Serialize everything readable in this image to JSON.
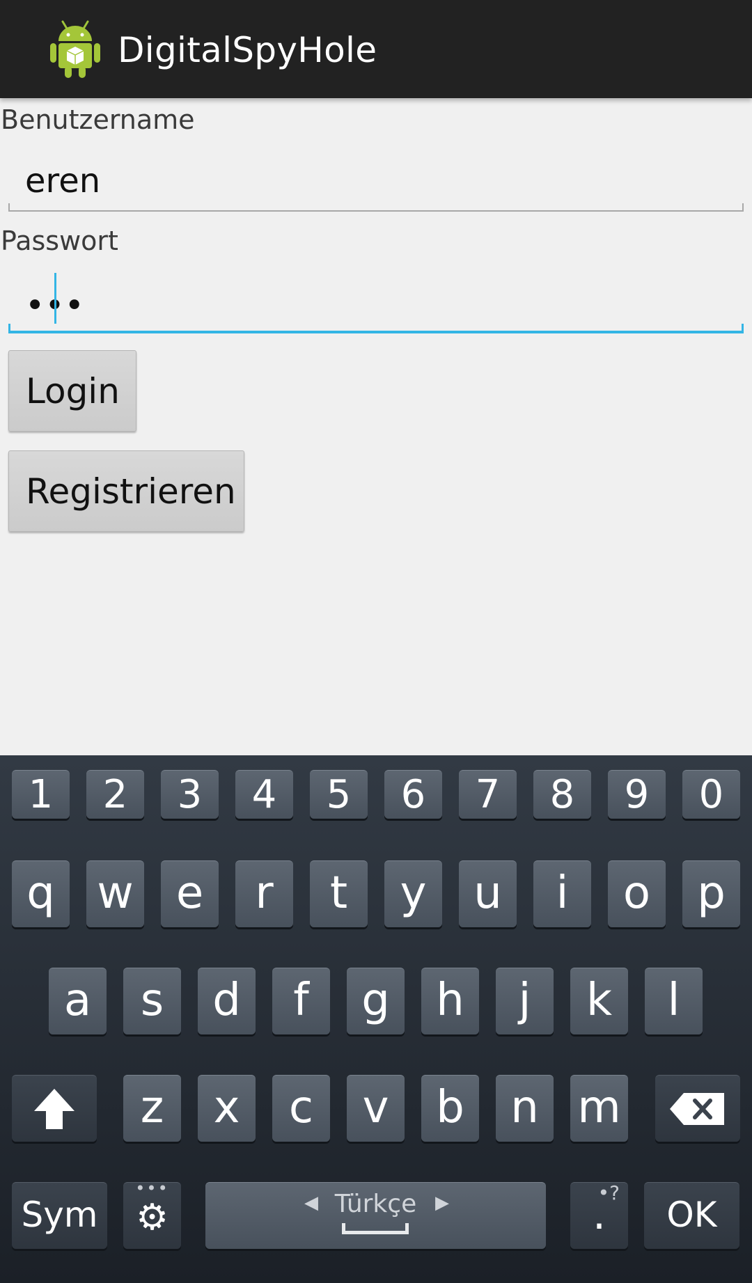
{
  "action_bar": {
    "title": "DigitalSpyHole",
    "icon": "android-robot-icon"
  },
  "form": {
    "username_label": "Benutzername",
    "username_value": "eren",
    "password_label": "Passwort",
    "password_value": "•••",
    "login_button": "Login",
    "register_button": "Registrieren"
  },
  "keyboard": {
    "number_row": [
      "1",
      "2",
      "3",
      "4",
      "5",
      "6",
      "7",
      "8",
      "9",
      "0"
    ],
    "row1": [
      "q",
      "w",
      "e",
      "r",
      "t",
      "y",
      "u",
      "i",
      "o",
      "p"
    ],
    "row2": [
      "a",
      "s",
      "d",
      "f",
      "g",
      "h",
      "j",
      "k",
      "l"
    ],
    "row3": [
      "z",
      "x",
      "c",
      "v",
      "b",
      "n",
      "m"
    ],
    "sym_label": "Sym",
    "language_label": "Türkçe",
    "period_label": ".",
    "period_hint": "•?",
    "ok_label": "OK",
    "settings_hint": "•••",
    "shift_icon": "shift-arrow-icon",
    "backspace_icon": "backspace-icon",
    "settings_icon": "gear-icon",
    "accent_color": "#33b5e5"
  }
}
